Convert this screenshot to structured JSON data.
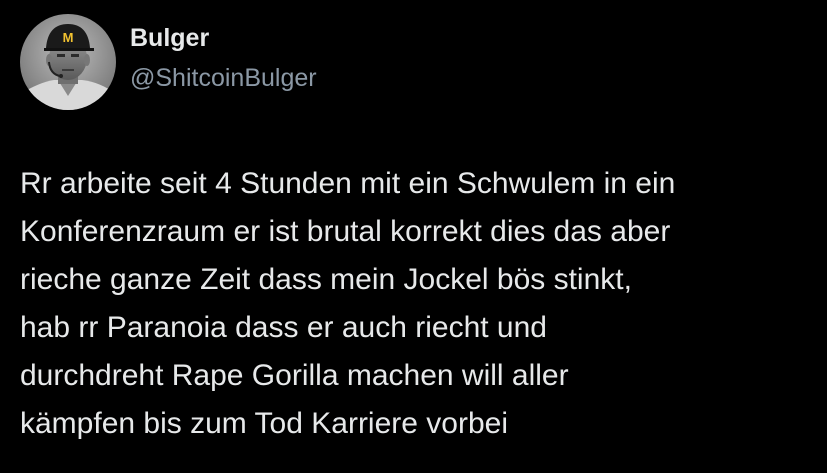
{
  "author": {
    "display_name": "Bulger",
    "handle": "@ShitcoinBulger",
    "avatar_logo_text": "M"
  },
  "tweet": {
    "lines": [
      "Rr arbeite seit 4 Stunden mit ein Schwulem in ein",
      "Konferenzraum er ist brutal korrekt dies das aber",
      "rieche ganze Zeit dass mein Jockel bös stinkt,",
      "hab rr Paranoia dass er auch riecht und",
      "durchdreht Rape Gorilla machen will aller",
      "kämpfen bis zum Tod Karriere vorbei"
    ]
  },
  "colors": {
    "background": "#000000",
    "text_primary": "#e7e9ea",
    "text_secondary": "#8b98a5",
    "logo_yellow": "#f2c230"
  }
}
